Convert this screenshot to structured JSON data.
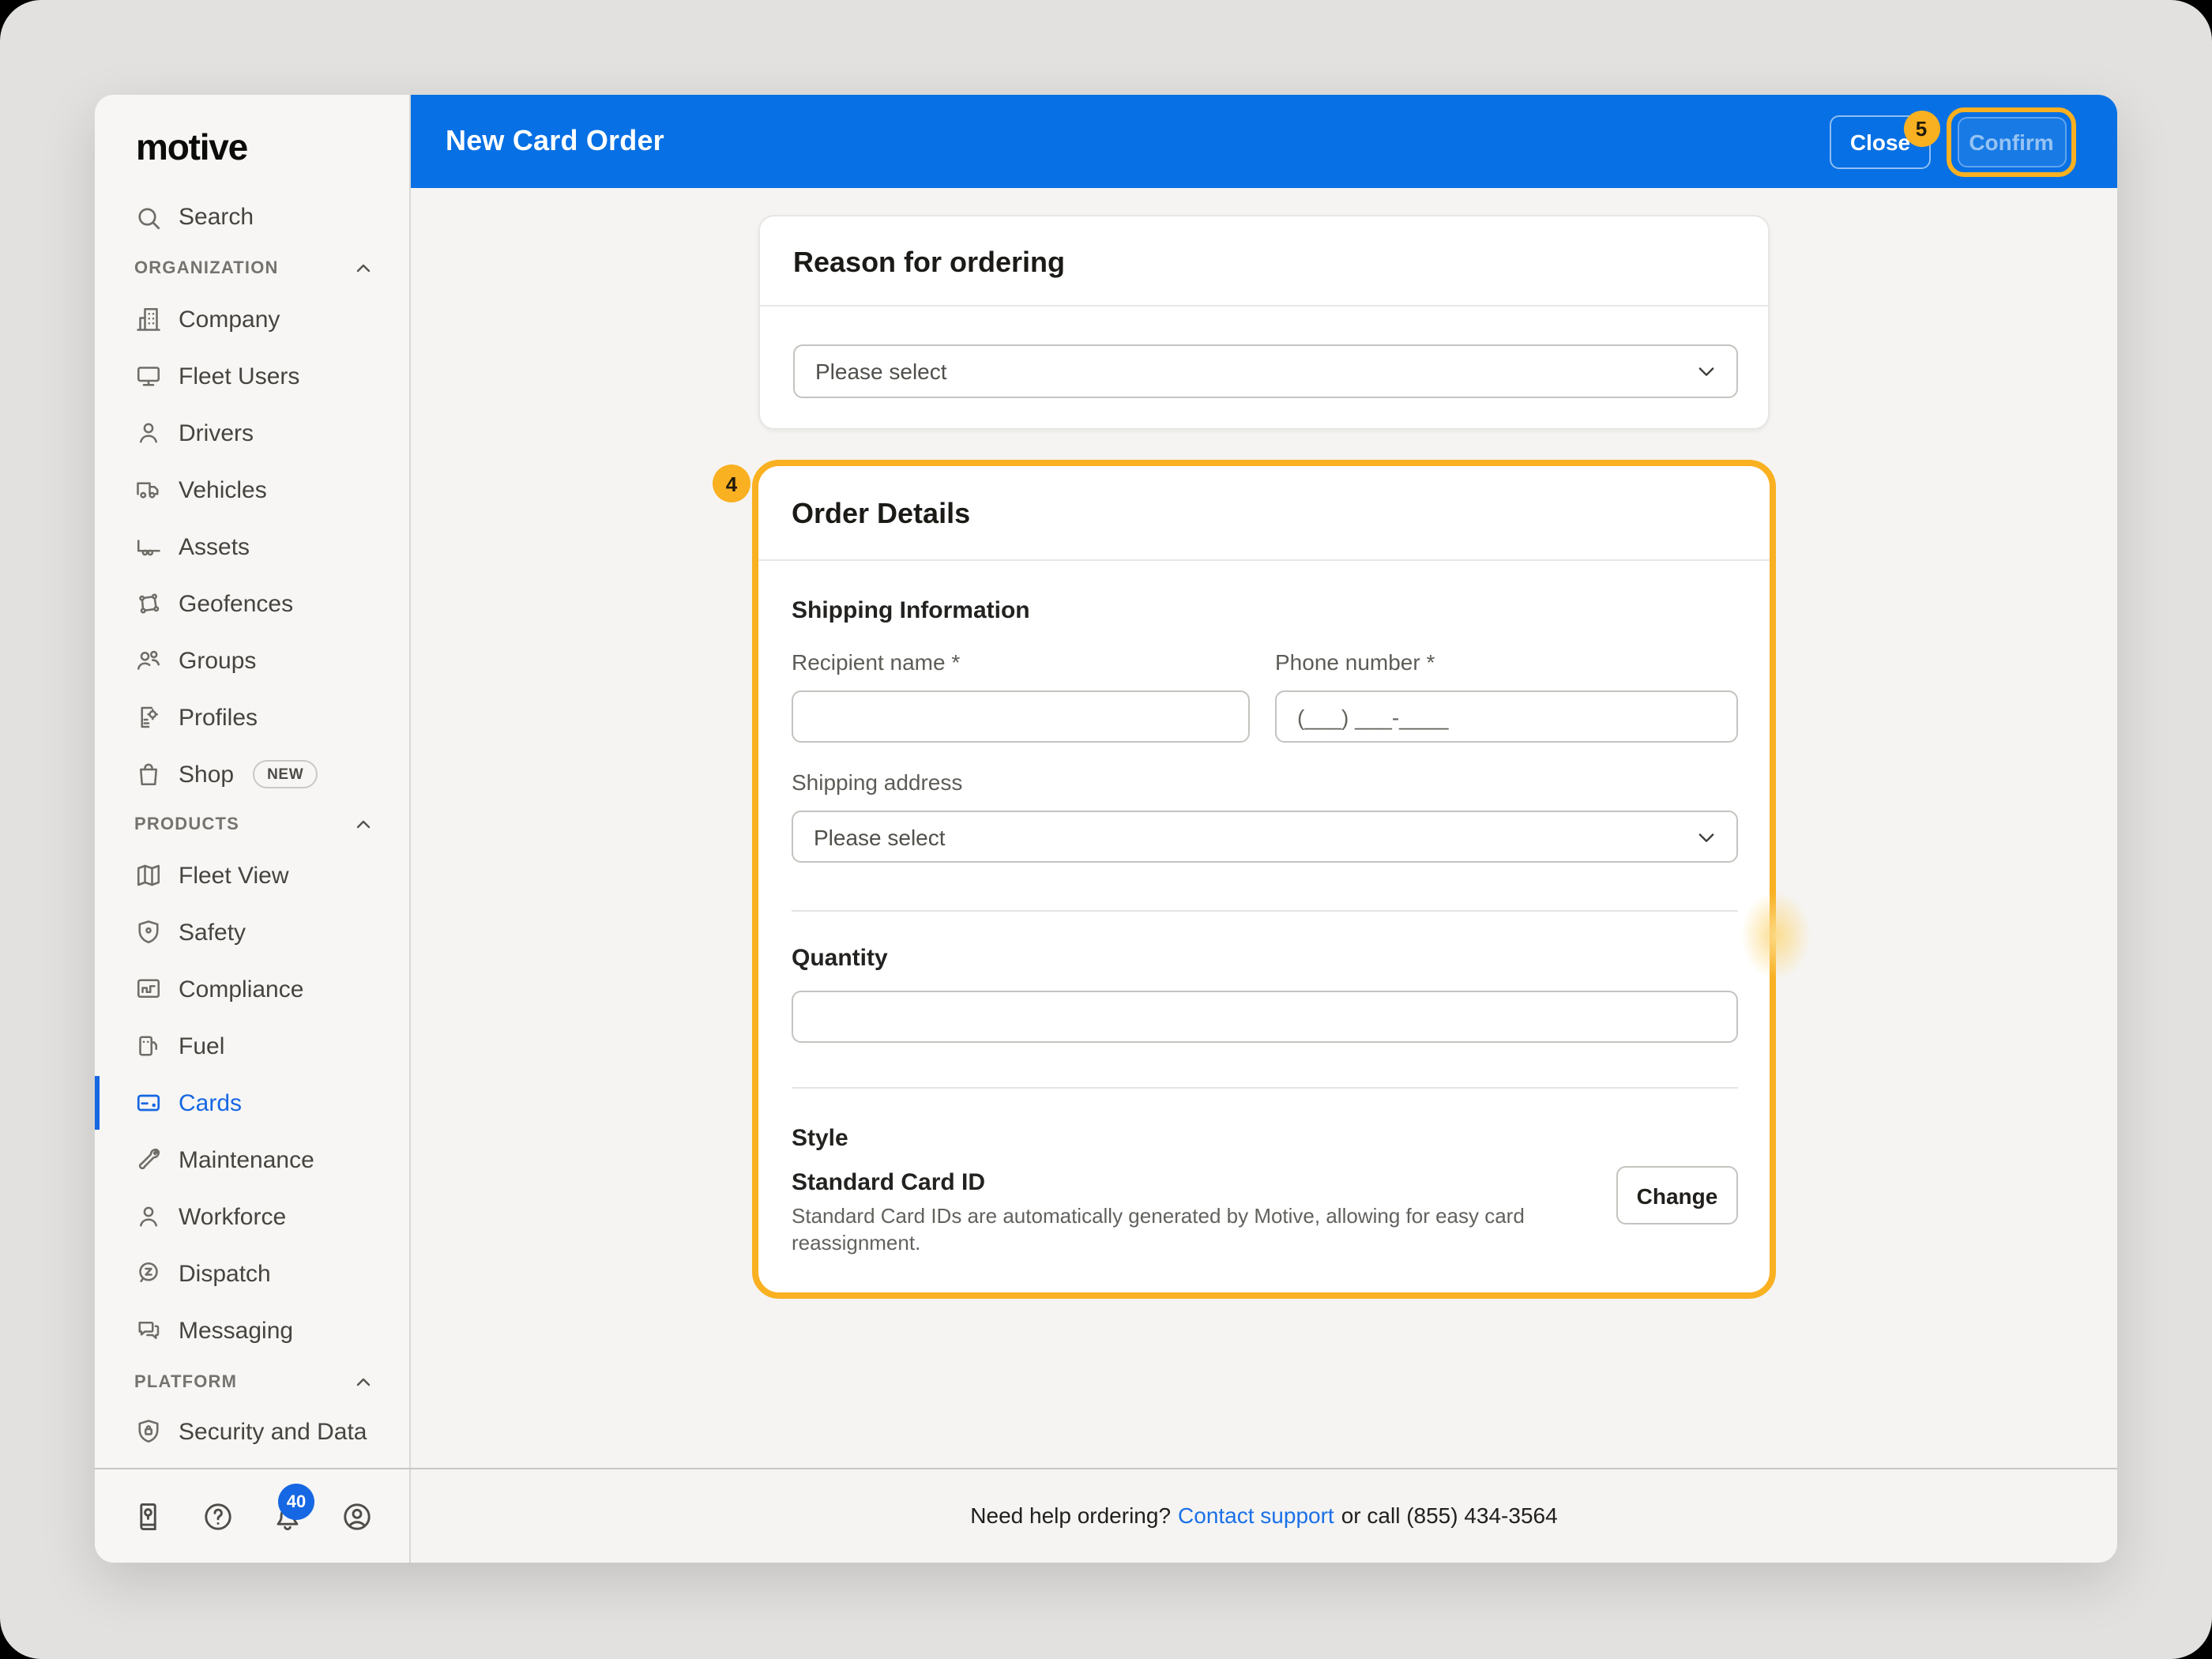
{
  "colors": {
    "header_blue": "#0770e4",
    "accent_blue": "#1667e2",
    "annotation_amber": "#f9b021",
    "link_blue": "#1a70e8",
    "sidebar_bg": "#f7f6f4",
    "content_bg": "#f5f4f2",
    "desktop_bg": "#e2e1df"
  },
  "header": {
    "title": "New Card Order",
    "close_label": "Close",
    "confirm_label": "Confirm"
  },
  "annotations": {
    "badge_on_close": "5",
    "badge_on_order_card": "4"
  },
  "sidebar": {
    "logo_text": "motive",
    "search_label": "Search",
    "sections": [
      {
        "label": "ORGANIZATION",
        "items": [
          {
            "label": "Company",
            "icon": "building-icon"
          },
          {
            "label": "Fleet Users",
            "icon": "monitor-icon"
          },
          {
            "label": "Drivers",
            "icon": "person-icon"
          },
          {
            "label": "Vehicles",
            "icon": "truck-icon"
          },
          {
            "label": "Assets",
            "icon": "trailer-icon"
          },
          {
            "label": "Geofences",
            "icon": "geofence-icon"
          },
          {
            "label": "Groups",
            "icon": "people-icon"
          },
          {
            "label": "Profiles",
            "icon": "profile-gear-icon"
          },
          {
            "label": "Shop",
            "icon": "shopping-bag-icon",
            "badge": "NEW"
          }
        ]
      },
      {
        "label": "PRODUCTS",
        "items": [
          {
            "label": "Fleet View",
            "icon": "map-icon"
          },
          {
            "label": "Safety",
            "icon": "shield-icon"
          },
          {
            "label": "Compliance",
            "icon": "compliance-icon"
          },
          {
            "label": "Fuel",
            "icon": "fuel-pump-icon"
          },
          {
            "label": "Cards",
            "icon": "credit-card-icon",
            "active": true
          },
          {
            "label": "Maintenance",
            "icon": "wrench-icon"
          },
          {
            "label": "Workforce",
            "icon": "person-icon"
          },
          {
            "label": "Dispatch",
            "icon": "dispatch-pin-icon"
          },
          {
            "label": "Messaging",
            "icon": "chat-icon"
          }
        ]
      },
      {
        "label": "PLATFORM",
        "items": [
          {
            "label": "Security and Data",
            "icon": "shield-lock-icon"
          }
        ]
      }
    ],
    "toolbar_icons": [
      "guide-icon",
      "help-icon",
      "bell-icon",
      "avatar-icon"
    ],
    "notification_count": "40"
  },
  "reason_card": {
    "title": "Reason for ordering",
    "select_value": "Please select"
  },
  "order_card": {
    "title": "Order Details",
    "shipping_heading": "Shipping Information",
    "recipient_label": "Recipient name *",
    "phone_label": "Phone number *",
    "recipient_value": "",
    "phone_placeholder": "(___) ___-____",
    "address_label": "Shipping address",
    "address_value": "Please select",
    "quantity_label": "Quantity",
    "quantity_value": "",
    "style_heading": "Style",
    "style_name": "Standard Card ID",
    "style_description": "Standard Card IDs are automatically generated by Motive, allowing for easy card reassignment.",
    "change_label": "Change"
  },
  "footer": {
    "prefix": "Need help ordering?",
    "link_label": "Contact support",
    "suffix": "or call (855) 434-3564"
  }
}
